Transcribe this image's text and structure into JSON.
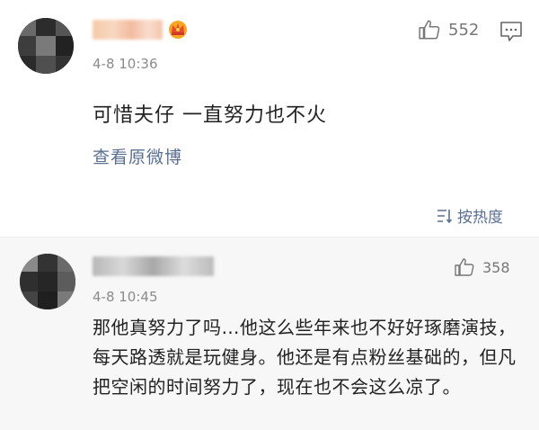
{
  "comments": [
    {
      "time": "4-8 10:36",
      "text": "可惜夫仔 一直努力也不火",
      "likes": "552",
      "link_label": "查看原微博"
    },
    {
      "time": "4-8 10:45",
      "text": "那他真努力了吗…他这么些年来也不好好琢磨演技，每天路透就是玩健身。他还是有点粉丝基础的，但凡把空闲的时间努力了，现在也不会这么凉了。",
      "likes": "358"
    }
  ],
  "sort_label": "按热度",
  "colors": {
    "link": "#5a6f92",
    "time": "#8c8c8c",
    "reply_bg": "#f7f7f7"
  },
  "icons": [
    "thumbs-up-icon",
    "comment-icon",
    "vip-crown-icon",
    "sort-icon"
  ]
}
